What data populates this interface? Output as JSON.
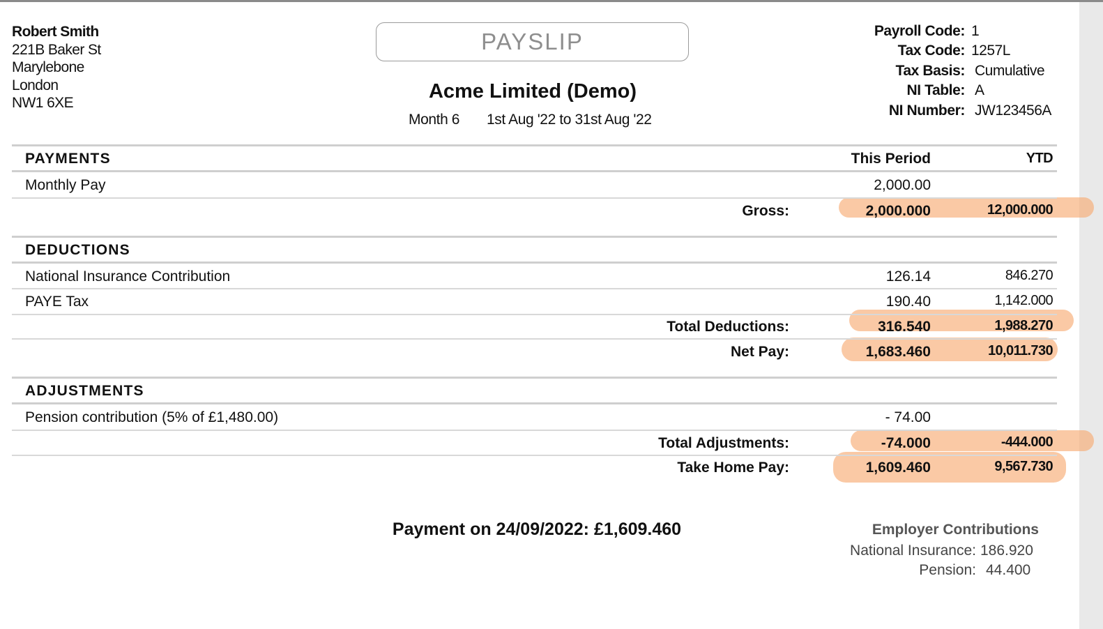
{
  "employee": {
    "name": "Robert Smith",
    "address": [
      "221B Baker St",
      "Marylebone",
      "London",
      "NW1 6XE"
    ]
  },
  "title": "PAYSLIP",
  "company": "Acme Limited (Demo)",
  "period": {
    "month": "Month 6",
    "range": "1st Aug '22 to 31st Aug '22"
  },
  "info": [
    {
      "label": "Payroll Code:",
      "value": "1"
    },
    {
      "label": "Tax Code:",
      "value": "1257L"
    },
    {
      "label": "Tax Basis:",
      "value": "Cumulative"
    },
    {
      "label": "NI Table:",
      "value": "A"
    },
    {
      "label": "NI Number:",
      "value": "JW123456A"
    }
  ],
  "payments": {
    "heading": "PAYMENTS",
    "col_this": "This Period",
    "col_ytd": "YTD",
    "rows": [
      {
        "label": "Monthly Pay",
        "this": "2,000.00",
        "ytd": ""
      }
    ],
    "total": {
      "label": "Gross:",
      "this": "2,000.000",
      "ytd": "12,000.000"
    }
  },
  "deductions": {
    "heading": "DEDUCTIONS",
    "rows": [
      {
        "label": "National Insurance Contribution",
        "this": "126.14",
        "ytd": "846.270"
      },
      {
        "label": "PAYE Tax",
        "this": "190.40",
        "ytd": "1,142.000"
      }
    ],
    "total": {
      "label": "Total Deductions:",
      "this": "316.540",
      "ytd": "1,988.270"
    },
    "net": {
      "label": "Net Pay:",
      "this": "1,683.460",
      "ytd": "10,011.730"
    }
  },
  "adjustments": {
    "heading": "ADJUSTMENTS",
    "rows": [
      {
        "label": "Pension contribution (5% of £1,480.00)",
        "this": "- 74.00",
        "ytd": ""
      }
    ],
    "total": {
      "label": "Total Adjustments:",
      "this": "-74.000",
      "ytd": "-444.000"
    },
    "take_home": {
      "label": "Take Home Pay:",
      "this": "1,609.460",
      "ytd": "9,567.730"
    }
  },
  "payment_line": "Payment on 24/09/2022: £1,609.460",
  "employer": {
    "heading": "Employer Contributions",
    "items": [
      {
        "label": "National Insurance:",
        "value": "186.920"
      },
      {
        "label": "Pension:",
        "value": "44.400"
      }
    ]
  },
  "highlight_color": "#f7a86e"
}
